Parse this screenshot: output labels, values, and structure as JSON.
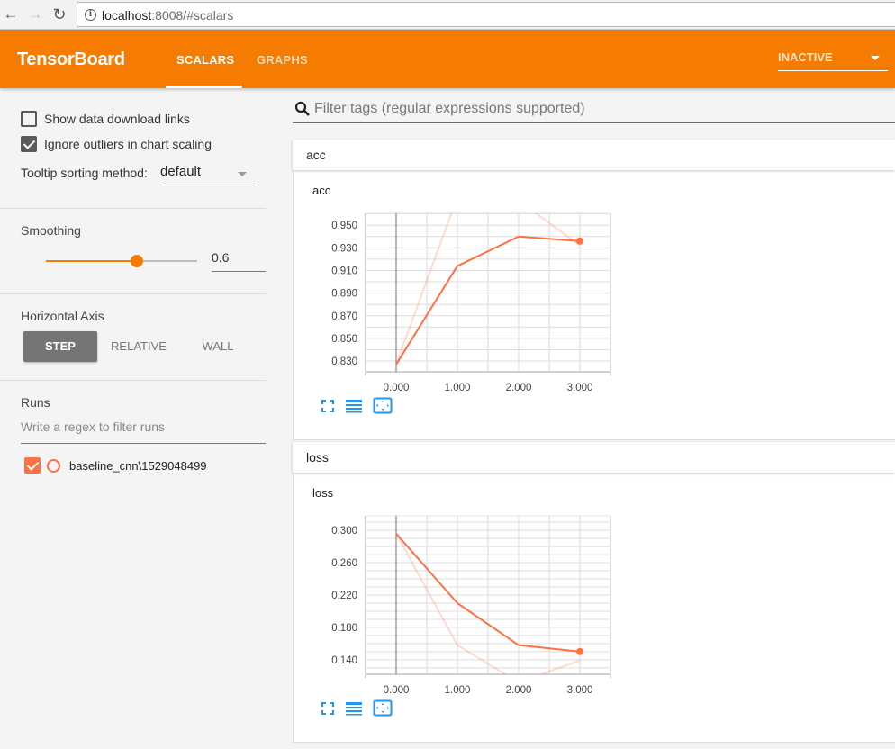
{
  "browser": {
    "url_host": "localhost",
    "url_rest": ":8008/#scalars"
  },
  "toolbar": {
    "brand": "TensorBoard",
    "tabs": [
      {
        "label": "SCALARS",
        "active": true
      },
      {
        "label": "GRAPHS",
        "active": false
      }
    ],
    "dashboard_select": "INACTIVE",
    "accent_color": "#f57c00"
  },
  "sidebar": {
    "show_download_links": {
      "label": "Show data download links",
      "checked": false
    },
    "ignore_outliers": {
      "label": "Ignore outliers in chart scaling",
      "checked": true
    },
    "tooltip_sorting": {
      "label": "Tooltip sorting method:",
      "value": "default"
    },
    "smoothing": {
      "title": "Smoothing",
      "value": 0.6,
      "value_text": "0.6"
    },
    "horizontal_axis": {
      "title": "Horizontal Axis",
      "options": [
        {
          "label": "STEP",
          "active": true
        },
        {
          "label": "RELATIVE",
          "active": false
        },
        {
          "label": "WALL",
          "active": false
        }
      ]
    },
    "runs": {
      "title": "Runs",
      "filter_placeholder": "Write a regex to filter runs",
      "items": [
        {
          "name": "baseline_cnn\\1529048499",
          "checked": true,
          "color": "#ff7043"
        }
      ]
    }
  },
  "main": {
    "filter_placeholder": "Filter tags (regular expressions supported)",
    "categories": [
      {
        "name": "acc",
        "card_title": "acc"
      },
      {
        "name": "loss",
        "card_title": "loss"
      }
    ],
    "card_icons": [
      "fullscreen-icon",
      "toggle-log-scale-icon",
      "fit-domain-icon"
    ]
  },
  "chart_data": [
    {
      "type": "line",
      "title": "acc",
      "xlabel": "",
      "ylabel": "",
      "x": [
        0,
        1,
        2,
        3
      ],
      "x_ticks": [
        "0.000",
        "1.000",
        "2.000",
        "3.000"
      ],
      "xlim": [
        -0.5,
        3.5
      ],
      "y_ticks": [
        "0.830",
        "0.850",
        "0.870",
        "0.890",
        "0.910",
        "0.930",
        "0.950"
      ],
      "ylim": [
        0.8205,
        0.9605
      ],
      "grid": true,
      "series": [
        {
          "name": "baseline_cnn\\1529048499 (smoothed)",
          "values": [
            0.827,
            0.914,
            0.94,
            0.936
          ],
          "color": "#ff7043",
          "opacity": 1
        },
        {
          "name": "baseline_cnn\\1529048499 (raw)",
          "values": [
            0.827,
            0.975,
            0.972,
            0.932
          ],
          "color": "#ff7043",
          "opacity": 0.25
        }
      ]
    },
    {
      "type": "line",
      "title": "loss",
      "xlabel": "",
      "ylabel": "",
      "x": [
        0,
        1,
        2,
        3
      ],
      "x_ticks": [
        "0.000",
        "1.000",
        "2.000",
        "3.000"
      ],
      "xlim": [
        -0.5,
        3.5
      ],
      "y_ticks": [
        "0.140",
        "0.160",
        "0.180",
        "0.200",
        "0.220",
        "0.240",
        "0.260",
        "0.280",
        "0.300"
      ],
      "y_tick_labels_shown": [
        "0.140",
        "0.180",
        "0.220",
        "0.260",
        "0.300"
      ],
      "ylim": [
        0.122,
        0.318
      ],
      "grid": true,
      "series": [
        {
          "name": "baseline_cnn\\1529048499 (smoothed)",
          "values": [
            0.296,
            0.21,
            0.158,
            0.15
          ],
          "color": "#ff7043",
          "opacity": 1
        },
        {
          "name": "baseline_cnn\\1529048499 (raw)",
          "values": [
            0.296,
            0.158,
            0.112,
            0.139
          ],
          "color": "#ff7043",
          "opacity": 0.25
        }
      ]
    }
  ]
}
